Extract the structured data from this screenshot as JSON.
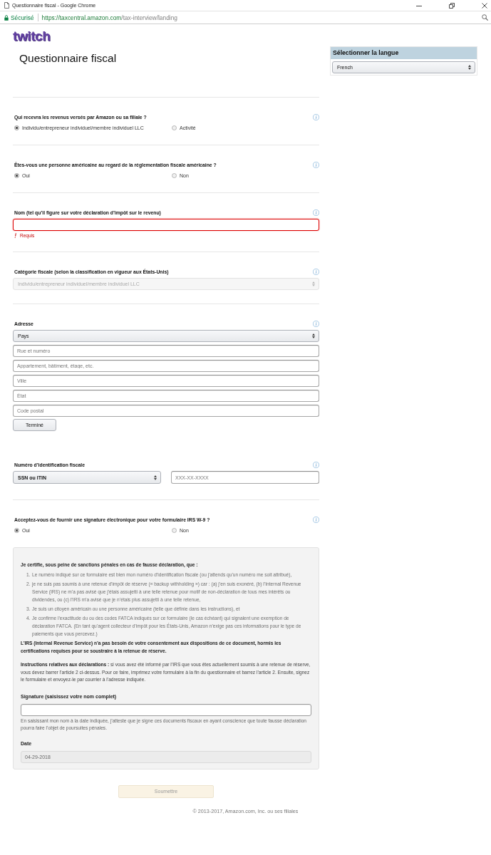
{
  "browser": {
    "title": "Questionnaire fiscal - Google Chrome",
    "security_label": "Sécurisé",
    "url_origin": "https://taxcentral.amazon.com",
    "url_path": "/tax-interview/landing"
  },
  "logo": "twitch",
  "page_title": "Questionnaire fiscal",
  "language_panel": {
    "heading": "Sélectionner la langue",
    "value": "French"
  },
  "sections": [
    {
      "kind": "radio",
      "label": "Qui recevra les revenus versés par Amazon ou sa filiale ?",
      "options": [
        {
          "label": "Individu/entrepreneur individuel/membre individuel LLC",
          "selected": true
        },
        {
          "label": "Activité",
          "selected": false
        }
      ]
    },
    {
      "kind": "radio",
      "label": "Êtes-vous une personne américaine au regard de la réglementation fiscale américaine ?",
      "options": [
        {
          "label": "Oui",
          "selected": true
        },
        {
          "label": "Non",
          "selected": false
        }
      ]
    },
    {
      "kind": "text",
      "label": "Nom (tel qu’il figure sur votre déclaration d’impôt sur le revenu)",
      "error": "Requis"
    },
    {
      "kind": "select",
      "label": "Catégorie fiscale (selon la classification en vigueur aux États-Unis)",
      "value": "Individu/entrepreneur individuel/membre individuel LLC",
      "disabled": true
    },
    {
      "kind": "address",
      "label": "Adresse",
      "country": "Pays",
      "fields": [
        {
          "placeholder": "Rue et numéro"
        },
        {
          "placeholder": "Appartement, bâtiment, étage, etc."
        },
        {
          "placeholder": "Ville"
        },
        {
          "placeholder": "État"
        },
        {
          "placeholder": "Code postal"
        }
      ],
      "button": "Terminé"
    },
    {
      "kind": "tin",
      "label": "Numéro d’identification fiscale",
      "type_value": "SSN ou ITIN",
      "placeholder": "XXX-XX-XXXX"
    },
    {
      "kind": "radio",
      "label": "Acceptez-vous de fournir une signature électronique pour votre formulaire IRS W-9 ?",
      "options": [
        {
          "label": "Oui",
          "selected": true
        },
        {
          "label": "Non",
          "selected": false
        }
      ]
    }
  ],
  "certification": {
    "intro": "Je certifie, sous peine de sanctions pénales en cas de fausse déclaration, que :",
    "items": [
      {
        "number": "1.",
        "text": "Le numéro indiqué sur ce formulaire est bien mon numéro d’identification fiscale (ou j’attends qu’un numéro me soit attribué),"
      },
      {
        "number": "2.",
        "text": "je ne suis pas soumis à une retenue d’impôt de réserve (« backup withholding ») car : (a) j’en suis exonéré, (b) l’Internal Revenue Service (IRS) ne m’a pas avisé que j’étais assujetti à une telle retenue pour motif de non-déclaration de tous mes intérêts ou dividendes, ou (c) l’IRS m’a avisé que je n’étais plus assujetti à une telle retenue,"
      },
      {
        "number": "3.",
        "text": "Je suis un citoyen américain ou une personne américaine (telle que définie dans les instructions), et"
      },
      {
        "number": "4.",
        "text": "Je confirme l’exactitude du ou des codes FATCA indiqués sur ce formulaire (le cas échéant) qui signalent une exemption de déclaration FATCA. (En tant qu’agent collecteur d’impôt pour les États-Unis, Amazon n’exige pas ces informations pour le type de paiements que vous percevez.)"
      }
    ],
    "notice": "L’IRS (Internal Revenue Service) n’a pas besoin de votre consentement aux dispositions de ce document, hormis les certifications requises pour se soustraire à la retenue de réserve.",
    "instructions": "**Instructions relatives aux déclarations :** si vous avez été informé par l’IRS que vous êtes actuellement soumis à une retenue de réserve, vous devez barrer l’article 2 ci-dessus. Pour ce faire, imprimez votre formulaire à la fin du questionnaire et barrez l’article 2. Ensuite, signez le formulaire et envoyez-le par courrier à l’adresse indiquée.",
    "signature_label": "Signature (saisissez votre nom complet)",
    "signature_note": "En saisissant mon nom à la date indiquée, j’atteste que je signe ces documents fiscaux en ayant conscience que toute fausse déclaration pourra faire l’objet de poursuites pénales.",
    "date_label": "Date",
    "date_value": "04-29-2018"
  },
  "submit": {
    "label": "Soumettre",
    "disabled": true
  },
  "footer": "© 2013-2017, Amazon.com, Inc. ou ses filiales"
}
